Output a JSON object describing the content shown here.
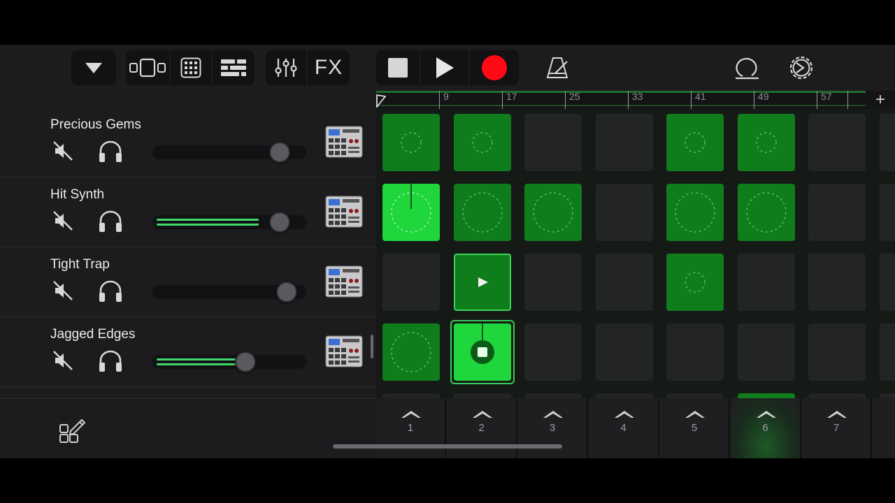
{
  "toolbar": {
    "fx_label": "FX",
    "record_color": "#ff0a14"
  },
  "ruler": {
    "markers": [
      "9",
      "17",
      "25",
      "33",
      "41",
      "49",
      "57"
    ],
    "add_label": "+"
  },
  "tracks": [
    {
      "name": "Precious Gems",
      "volume_fraction": 0.88,
      "level_fill": 0
    },
    {
      "name": "Hit Synth",
      "volume_fraction": 0.88,
      "level_fill": 0.7
    },
    {
      "name": "Tight Trap",
      "volume_fraction": 0.93,
      "level_fill": 0
    },
    {
      "name": "Jagged Edges",
      "volume_fraction": 0.62,
      "level_fill": 0.62
    }
  ],
  "grid": {
    "rows": [
      [
        "loop",
        "loop",
        "empty",
        "empty",
        "loop",
        "loop",
        "empty"
      ],
      [
        "playing",
        "loop",
        "loop",
        "empty",
        "loop",
        "loop",
        "empty"
      ],
      [
        "empty",
        "queued",
        "empty",
        "empty",
        "loop",
        "empty",
        "empty"
      ],
      [
        "loop",
        "stopping",
        "empty",
        "empty",
        "empty",
        "empty",
        "empty"
      ]
    ]
  },
  "triggers": {
    "columns": [
      "1",
      "2",
      "3",
      "4",
      "5",
      "6",
      "7"
    ],
    "lit_column": "6"
  },
  "colors": {
    "accent_green": "#1fd63c",
    "loop_green": "#0f7d1c",
    "meter_green": "#3fd96c"
  }
}
